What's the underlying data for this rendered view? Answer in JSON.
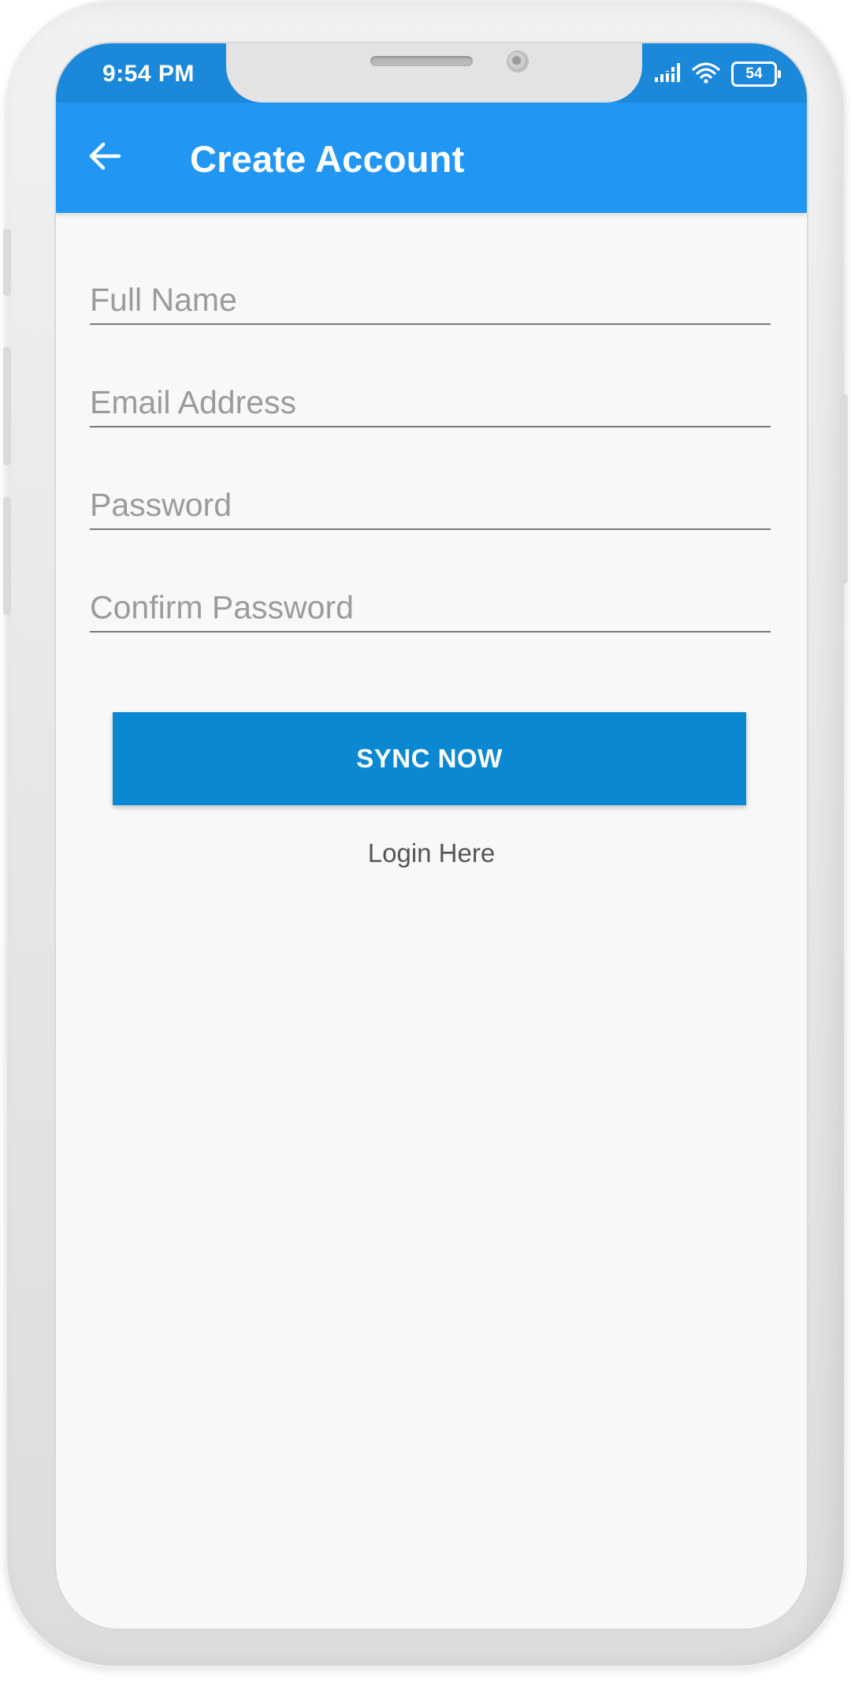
{
  "status_bar": {
    "time": "9:54 PM",
    "battery": "54",
    "icons": [
      "signal-icon",
      "wifi-icon",
      "battery-icon"
    ]
  },
  "app_bar": {
    "title": "Create Account",
    "back_icon": "arrow-left-icon"
  },
  "form": {
    "full_name": {
      "placeholder": "Full Name",
      "value": ""
    },
    "email": {
      "placeholder": "Email Address",
      "value": ""
    },
    "password": {
      "placeholder": "Password",
      "value": ""
    },
    "confirm_password": {
      "placeholder": "Confirm Password",
      "value": ""
    }
  },
  "actions": {
    "sync_label": "SYNC NOW",
    "login_label": "Login Here"
  },
  "colors": {
    "status_bar": "#1c88da",
    "app_bar": "#2196f3",
    "primary_button": "#0a88d1",
    "screen_background": "#f8f8f8"
  }
}
